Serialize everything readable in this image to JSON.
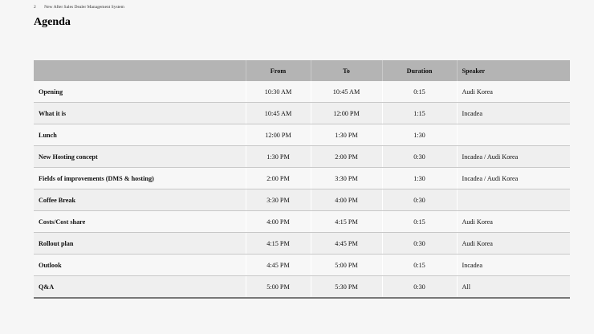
{
  "header": {
    "page_number": "2",
    "document_title": "New After Sales Dealer Management System"
  },
  "title": "Agenda",
  "table": {
    "columns": {
      "item": "",
      "from": "From",
      "to": "To",
      "duration": "Duration",
      "speaker": "Speaker"
    },
    "rows": [
      {
        "item": "Opening",
        "from": "10:30 AM",
        "to": "10:45 AM",
        "duration": "0:15",
        "speaker": "Audi Korea"
      },
      {
        "item": "What it is",
        "from": "10:45 AM",
        "to": "12:00 PM",
        "duration": "1:15",
        "speaker": "Incadea"
      },
      {
        "item": "Lunch",
        "from": "12:00 PM",
        "to": "1:30 PM",
        "duration": "1:30",
        "speaker": ""
      },
      {
        "item": "New Hosting concept",
        "from": "1:30 PM",
        "to": "2:00 PM",
        "duration": "0:30",
        "speaker": "Incadea / Audi Korea"
      },
      {
        "item": "Fields of improvements (DMS & hosting)",
        "from": "2:00 PM",
        "to": "3:30 PM",
        "duration": "1:30",
        "speaker": "Incadea / Audi Korea"
      },
      {
        "item": "Coffee Break",
        "from": "3:30 PM",
        "to": "4:00 PM",
        "duration": "0:30",
        "speaker": ""
      },
      {
        "item": "Costs/Cost share",
        "from": "4:00 PM",
        "to": "4:15 PM",
        "duration": "0:15",
        "speaker": "Audi Korea"
      },
      {
        "item": "Rollout plan",
        "from": "4:15 PM",
        "to": "4:45 PM",
        "duration": "0:30",
        "speaker": "Audi Korea"
      },
      {
        "item": "Outlook",
        "from": "4:45 PM",
        "to": "5:00 PM",
        "duration": "0:15",
        "speaker": "Incadea"
      },
      {
        "item": "Q&A",
        "from": "5:00 PM",
        "to": "5:30 PM",
        "duration": "0:30",
        "speaker": "All"
      }
    ]
  }
}
